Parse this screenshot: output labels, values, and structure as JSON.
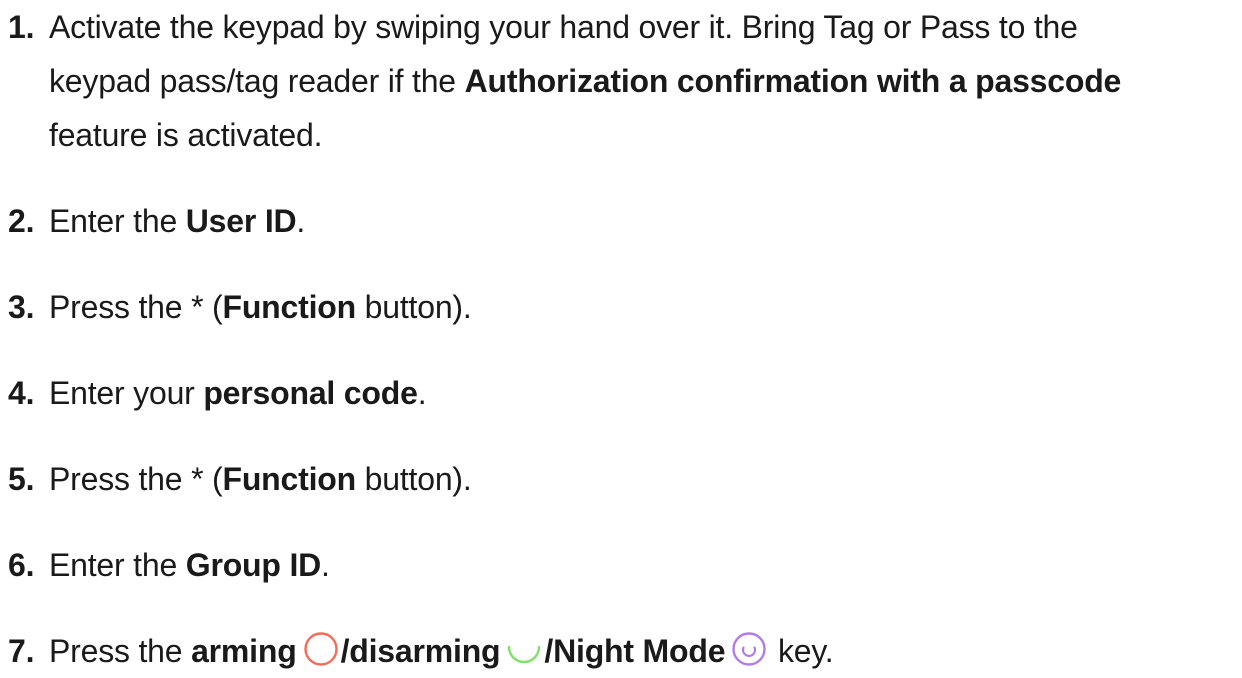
{
  "steps": [
    {
      "num": "1.",
      "line1": "Activate the keypad by swiping your hand over it. Bring Tag or Pass to the",
      "line2_plain": "keypad pass/tag reader if the ",
      "line2_bold": "Authorization confirmation with a passcode",
      "line3": "feature is activated."
    },
    {
      "num": "2.",
      "pre": "Enter the ",
      "bold": "User ID",
      "post": "."
    },
    {
      "num": "3.",
      "pre": "Press the * (",
      "bold": "Function",
      "post": " button)."
    },
    {
      "num": "4.",
      "pre": "Enter your ",
      "bold": "personal code",
      "post": "."
    },
    {
      "num": "5.",
      "pre": "Press the * (",
      "bold": "Function",
      "post": " button)."
    },
    {
      "num": "6.",
      "pre": "Enter the ",
      "bold": "Group ID",
      "post": "."
    },
    {
      "num": "7.",
      "pre": "Press the ",
      "arming": "arming",
      "disarming": "/disarming",
      "night": "/Night Mode",
      "post": " key."
    }
  ],
  "icons": {
    "arming": {
      "name": "arming-circle-icon",
      "color": "#f26b5b"
    },
    "disarming": {
      "name": "disarming-arc-icon",
      "color": "#7fe06a"
    },
    "night": {
      "name": "night-mode-icon",
      "color": "#b07ce8"
    }
  }
}
